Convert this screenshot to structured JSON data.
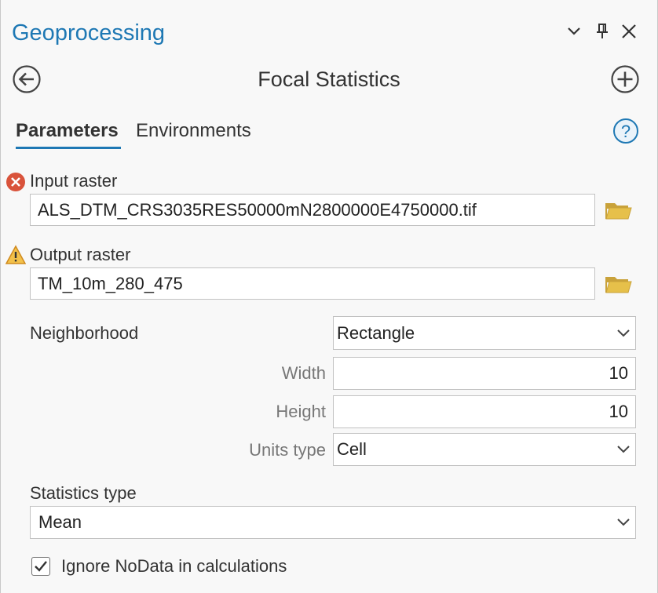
{
  "header": {
    "title": "Geoprocessing"
  },
  "window_buttons": [
    {
      "name": "options-chevron-icon"
    },
    {
      "name": "pin-icon"
    },
    {
      "name": "close-icon"
    }
  ],
  "tool": {
    "title": "Focal Statistics"
  },
  "tabs": [
    {
      "label": "Parameters",
      "active": true
    },
    {
      "label": "Environments",
      "active": false
    }
  ],
  "params": {
    "input_raster": {
      "label": "Input raster",
      "value": "ALS_DTM_CRS3035RES50000mN2800000E4750000.tif",
      "status": "error"
    },
    "output_raster": {
      "label": "Output raster",
      "value": "TM_10m_280_475",
      "status": "warning"
    },
    "neighborhood": {
      "label": "Neighborhood",
      "value": "Rectangle"
    },
    "width": {
      "label": "Width",
      "value": "10"
    },
    "height": {
      "label": "Height",
      "value": "10"
    },
    "units_type": {
      "label": "Units type",
      "value": "Cell"
    },
    "statistics_type": {
      "label": "Statistics type",
      "value": "Mean"
    },
    "ignore_nodata": {
      "label": "Ignore NoData in calculations",
      "checked": true
    }
  },
  "colors": {
    "accent": "#1e78b4",
    "error": "#d9533b",
    "warning": "#e8a33a",
    "folder": "#e6c04a"
  }
}
